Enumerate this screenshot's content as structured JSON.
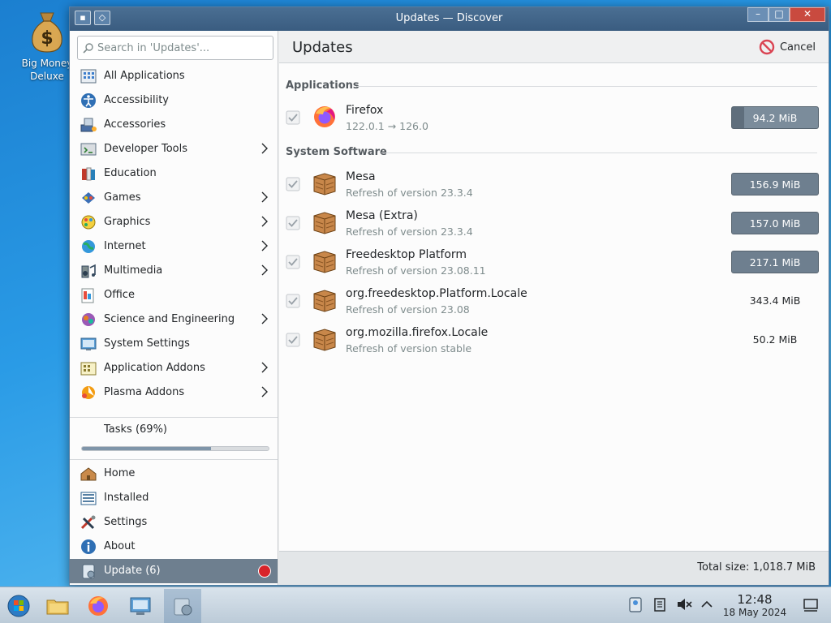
{
  "desktop": {
    "icon_label": "Big Money Deluxe"
  },
  "window": {
    "title": "Updates — Discover"
  },
  "sidebar": {
    "search_placeholder": "Search in 'Updates'...",
    "categories": [
      {
        "label": "All Applications",
        "icon": "all-applications-icon",
        "has_children": false
      },
      {
        "label": "Accessibility",
        "icon": "accessibility-icon",
        "has_children": false
      },
      {
        "label": "Accessories",
        "icon": "accessories-icon",
        "has_children": false
      },
      {
        "label": "Developer Tools",
        "icon": "developer-tools-icon",
        "has_children": true
      },
      {
        "label": "Education",
        "icon": "education-icon",
        "has_children": false
      },
      {
        "label": "Games",
        "icon": "games-icon",
        "has_children": true
      },
      {
        "label": "Graphics",
        "icon": "graphics-icon",
        "has_children": true
      },
      {
        "label": "Internet",
        "icon": "internet-icon",
        "has_children": true
      },
      {
        "label": "Multimedia",
        "icon": "multimedia-icon",
        "has_children": true
      },
      {
        "label": "Office",
        "icon": "office-icon",
        "has_children": false
      },
      {
        "label": "Science and Engineering",
        "icon": "science-icon",
        "has_children": true
      },
      {
        "label": "System Settings",
        "icon": "system-settings-icon",
        "has_children": false
      },
      {
        "label": "Application Addons",
        "icon": "application-addons-icon",
        "has_children": true
      },
      {
        "label": "Plasma Addons",
        "icon": "plasma-addons-icon",
        "has_children": true
      }
    ],
    "tasks_label": "Tasks (69%)",
    "tasks_progress": 0.69,
    "nav": [
      {
        "label": "Home",
        "icon": "home-icon"
      },
      {
        "label": "Installed",
        "icon": "installed-icon"
      },
      {
        "label": "Settings",
        "icon": "settings-icon"
      },
      {
        "label": "About",
        "icon": "about-icon"
      },
      {
        "label": "Update (6)",
        "icon": "update-icon",
        "active": true
      }
    ]
  },
  "main": {
    "title": "Updates",
    "cancel_label": "Cancel",
    "sections": [
      {
        "header": "Applications",
        "items": [
          {
            "name": "Firefox",
            "subtitle": "122.0.1 → 126.0",
            "size": "94.2 MiB",
            "state": "downloading"
          }
        ]
      },
      {
        "header": "System Software",
        "items": [
          {
            "name": "Mesa",
            "subtitle": "Refresh of version 23.3.4",
            "size": "156.9 MiB",
            "state": "pending"
          },
          {
            "name": "Mesa (Extra)",
            "subtitle": "Refresh of version 23.3.4",
            "size": "157.0 MiB",
            "state": "pending"
          },
          {
            "name": "Freedesktop Platform",
            "subtitle": "Refresh of version 23.08.11",
            "size": "217.1 MiB",
            "state": "pending"
          },
          {
            "name": "org.freedesktop.Platform.Locale",
            "subtitle": "Refresh of version 23.08",
            "size": "343.4 MiB",
            "state": "plain"
          },
          {
            "name": "org.mozilla.firefox.Locale",
            "subtitle": "Refresh of version stable",
            "size": "50.2 MiB",
            "state": "plain"
          }
        ]
      }
    ],
    "total_size": "Total size: 1,018.7 MiB"
  },
  "taskbar": {
    "time": "12:48",
    "date": "18 May 2024"
  },
  "colors": {
    "accent": "#6e7f8f",
    "titlebar": "#3a5c80",
    "desktop": "#2a9be6",
    "badge": "#d8242a"
  }
}
